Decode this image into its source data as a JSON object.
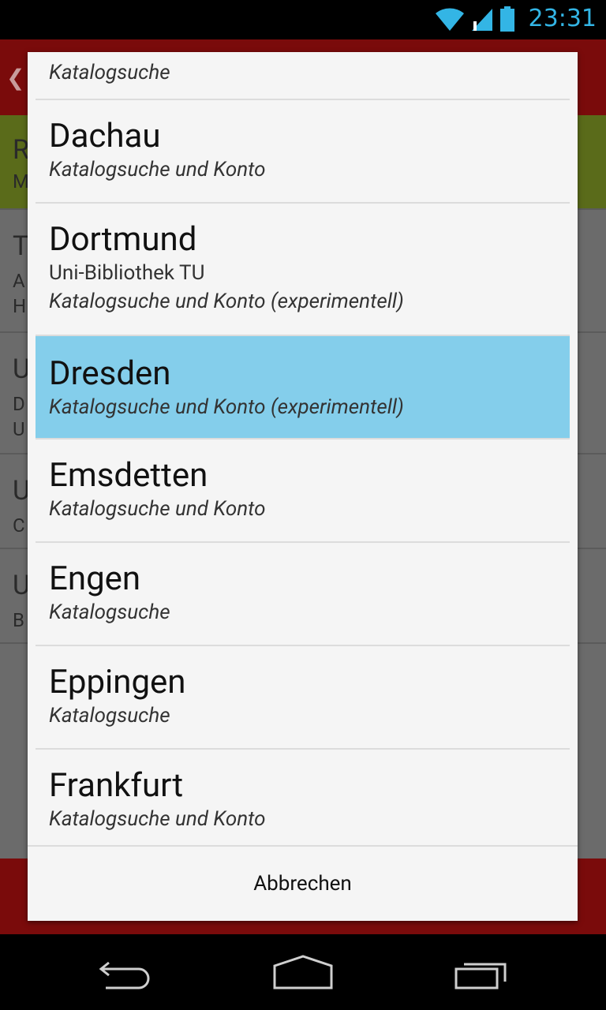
{
  "status_bar": {
    "time": "23:31",
    "accent": "#33b5e5"
  },
  "dialog": {
    "items": [
      {
        "title": "",
        "subtitle": "",
        "status": "Katalogsuche"
      },
      {
        "title": "Dachau",
        "subtitle": "",
        "status": "Katalogsuche und Konto"
      },
      {
        "title": "Dortmund",
        "subtitle": "Uni-Bibliothek TU",
        "status": "Katalogsuche und Konto (experimentell)"
      },
      {
        "title": "Dresden",
        "subtitle": "",
        "status": "Katalogsuche und Konto (experimentell)"
      },
      {
        "title": "Emsdetten",
        "subtitle": "",
        "status": "Katalogsuche und Konto"
      },
      {
        "title": "Engen",
        "subtitle": "",
        "status": "Katalogsuche"
      },
      {
        "title": "Eppingen",
        "subtitle": "",
        "status": "Katalogsuche"
      },
      {
        "title": "Frankfurt",
        "subtitle": "",
        "status": "Katalogsuche und Konto"
      }
    ],
    "cancel_label": "Abbrechen",
    "selected_color": "#84ceeb"
  },
  "background_app": {
    "row_initials": [
      "R",
      "M",
      "T",
      "A",
      "H",
      "U",
      "D",
      "U",
      "U",
      "C",
      "U",
      "B"
    ]
  },
  "nav_bar": {
    "icons": [
      "back-icon",
      "home-icon",
      "recents-icon"
    ]
  }
}
